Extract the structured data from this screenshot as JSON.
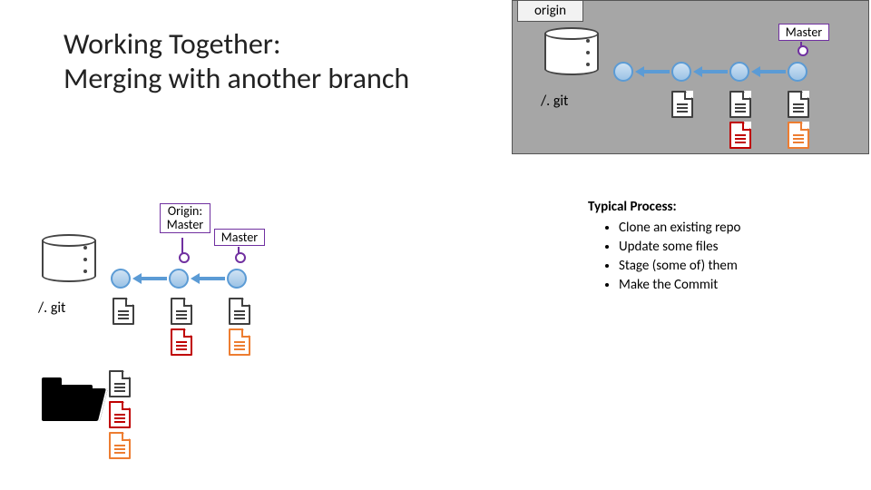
{
  "title_line1": "Working Together:",
  "title_line2": "Merging with another branch",
  "origin_tab": "origin",
  "origin_gitlabel": "/. git",
  "origin_master_tag": "Master",
  "local_gitlabel": "/. git",
  "local_tag_origin_master": "Origin:\nMaster",
  "local_tag_master": "Master",
  "process_heading": "Typical Process:",
  "process_items": [
    "Clone an existing repo",
    "Update some files",
    "Stage (some of) them",
    "Make the Commit"
  ]
}
